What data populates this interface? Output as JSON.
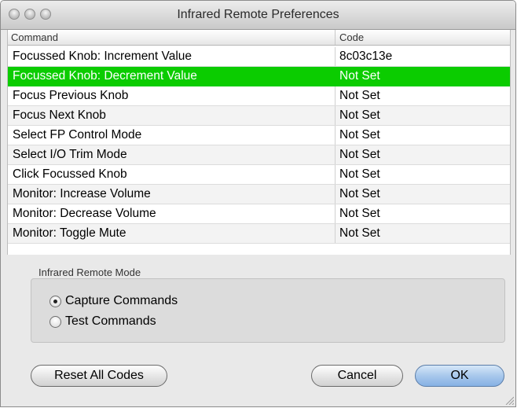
{
  "window": {
    "title": "Infrared Remote Preferences"
  },
  "table": {
    "headers": {
      "command": "Command",
      "code": "Code"
    },
    "rows": [
      {
        "command": "Focussed Knob: Increment Value",
        "code": "8c03c13e"
      },
      {
        "command": "Focussed Knob: Decrement Value",
        "code": "Not Set",
        "selected": true
      },
      {
        "command": "Focus Previous Knob",
        "code": "Not Set"
      },
      {
        "command": "Focus Next Knob",
        "code": "Not Set"
      },
      {
        "command": "Select FP Control Mode",
        "code": "Not Set"
      },
      {
        "command": "Select I/O Trim Mode",
        "code": "Not Set"
      },
      {
        "command": "Click Focussed Knob",
        "code": "Not Set"
      },
      {
        "command": "Monitor: Increase Volume",
        "code": "Not Set"
      },
      {
        "command": "Monitor: Decrease Volume",
        "code": "Not Set"
      },
      {
        "command": "Monitor: Toggle Mute",
        "code": "Not Set"
      }
    ]
  },
  "mode": {
    "label": "Infrared Remote Mode",
    "options": [
      {
        "label": "Capture Commands",
        "selected": true
      },
      {
        "label": "Test Commands",
        "selected": false
      }
    ]
  },
  "buttons": {
    "reset": "Reset All Codes",
    "cancel": "Cancel",
    "ok": "OK"
  },
  "colors": {
    "selection": "#0bcc00",
    "default_button": "#86b1e4"
  }
}
